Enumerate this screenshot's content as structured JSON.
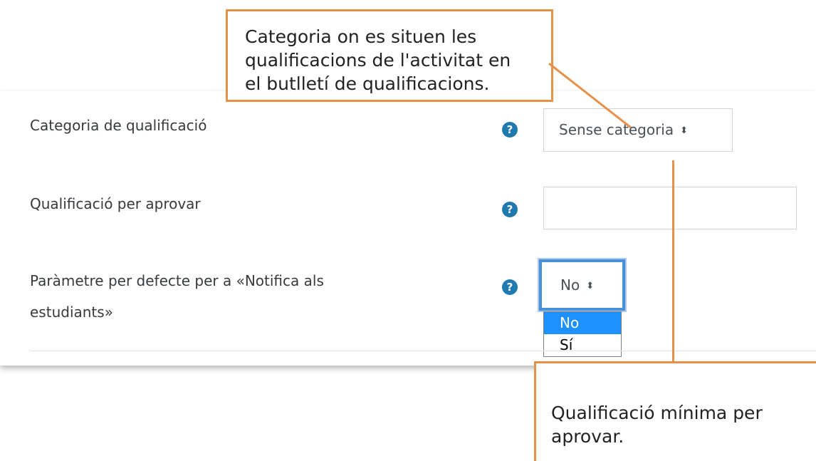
{
  "form": {
    "grade_category": {
      "label": "Categoria de qualificació",
      "help_icon": "question-circle-icon",
      "selected": "Sense categoria",
      "arrow": "⬍"
    },
    "grade_to_pass": {
      "label": "Qualificació per aprovar",
      "help_icon": "question-circle-icon",
      "value": ""
    },
    "notify_students": {
      "label_line1": "Paràmetre per defecte per a «Notifica als",
      "label_line2": "estudiants»",
      "help_icon": "question-circle-icon",
      "selected": "No",
      "arrow": "⬍",
      "options": [
        "No",
        "Sí"
      ],
      "highlighted_option": "No"
    }
  },
  "callouts": {
    "top": {
      "line1": "Categoria on es situen les",
      "line2": "qualificacions de l'activitat en",
      "line3": "el butlletí de qualificacions."
    },
    "bottom": {
      "line1": "Qualificació mínima per",
      "line2": "aprovar."
    }
  },
  "colors": {
    "callout_border": "#e5914a",
    "help_icon": "#1f7ab0",
    "focus_ring": "#4a90d9",
    "option_highlight": "#1e90ff"
  }
}
